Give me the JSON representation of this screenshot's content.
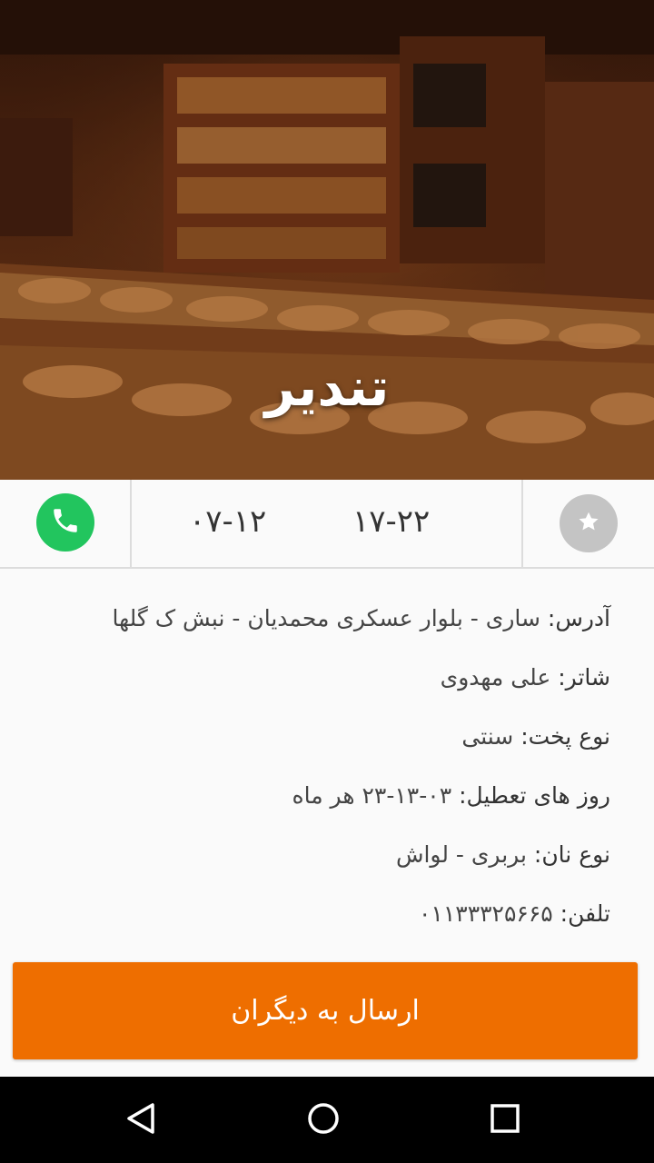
{
  "bakery": {
    "name": "تندیر"
  },
  "hours": {
    "morning": "۰۷-۱۲",
    "evening": "۱۷-۲۲"
  },
  "details": [
    {
      "label": "آدرس:",
      "value": "ساری - بلوار عسکری محمدیان - نبش ک گلها"
    },
    {
      "label": "شاتر:",
      "value": "علی مهدوی"
    },
    {
      "label": "نوع پخت:",
      "value": "سنتی"
    },
    {
      "label": "روز های تعطیل:",
      "value": "۰۳-۱۳-۲۳ هر ماه"
    },
    {
      "label": "نوع نان:",
      "value": "بربری - لواش"
    },
    {
      "label": "تلفن:",
      "value": "۰۱۱۳۳۳۲۵۶۶۵"
    }
  ],
  "actions": {
    "share_label": "ارسال به دیگران"
  },
  "icons": {
    "call": "phone-icon",
    "favorite": "star-icon",
    "back": "back-triangle-icon",
    "home": "home-circle-icon",
    "recents": "recents-square-icon"
  },
  "colors": {
    "call_green": "#22c55e",
    "share_orange": "#ee6e00",
    "favorite_gray": "#c4c4c4"
  }
}
